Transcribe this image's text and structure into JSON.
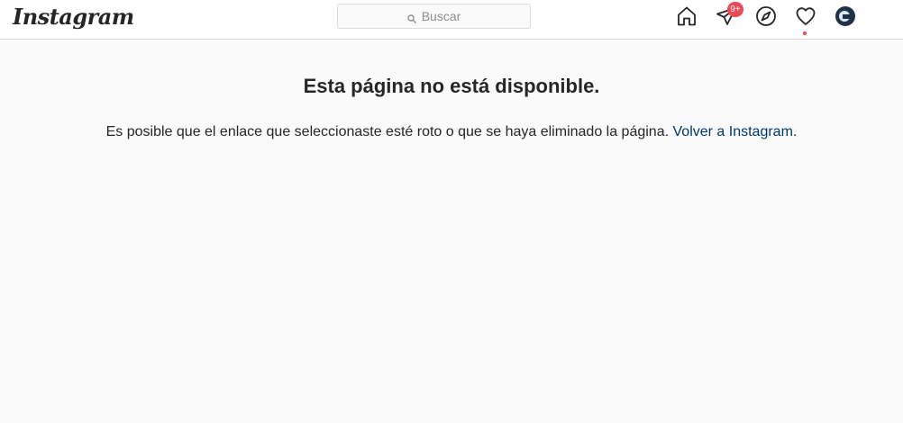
{
  "header": {
    "logo_text": "Instagram",
    "search": {
      "placeholder": "Buscar",
      "icon": "search-icon"
    },
    "nav": {
      "home_icon": "home-icon",
      "direct_icon": "direct-messages-icon",
      "direct_badge": "9+",
      "explore_icon": "explore-compass-icon",
      "activity_icon": "heart-icon",
      "profile_icon": "avatar"
    },
    "colors": {
      "badge": "#ed4956",
      "link": "#00376b"
    }
  },
  "main": {
    "title": "Esta página no está disponible.",
    "message": "Es posible que el enlace que seleccionaste esté roto o que se haya eliminado la página.",
    "link_text": "Volver a Instagram",
    "trailing": "."
  }
}
